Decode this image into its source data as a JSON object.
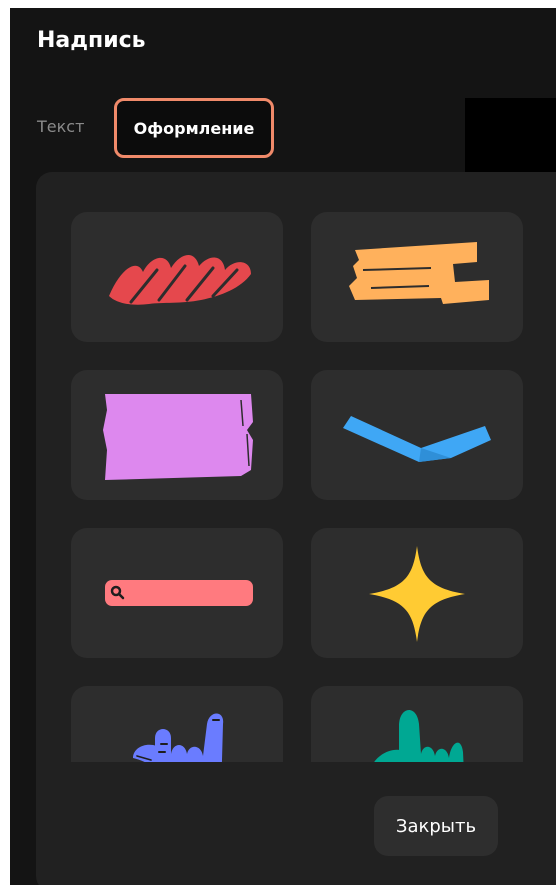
{
  "header": {
    "title": "Надпись"
  },
  "tabs": [
    {
      "label": "Текст",
      "selected": false
    },
    {
      "label": "Оформление",
      "selected": true
    }
  ],
  "styles": [
    {
      "icon": "red-scribble-icon",
      "color": "#e5484d"
    },
    {
      "icon": "orange-torn-tape-icon",
      "color": "#ffb15c"
    },
    {
      "icon": "purple-paper-note-icon",
      "color": "#dd88ee"
    },
    {
      "icon": "blue-chevron-ribbon-icon",
      "color": "#3fa7f5"
    },
    {
      "icon": "search-bar-icon",
      "color": "#ff7a7f"
    },
    {
      "icon": "yellow-sparkle-star-icon",
      "color": "#ffcb33"
    },
    {
      "icon": "blue-hand-icon",
      "color": "#6a7cff"
    },
    {
      "icon": "teal-hand-icon",
      "color": "#00a893"
    }
  ],
  "footer": {
    "close_label": "Закрыть"
  },
  "colors": {
    "background": "#141414",
    "panel": "#212121",
    "tile": "#2d2d2d",
    "selected_tab_border": "#f08a6a"
  }
}
